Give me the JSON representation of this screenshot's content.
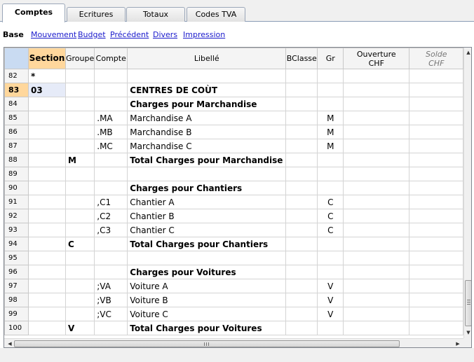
{
  "tabs": [
    {
      "label": "Comptes",
      "active": true
    },
    {
      "label": "Ecritures",
      "active": false
    },
    {
      "label": "Totaux",
      "active": false
    },
    {
      "label": "Codes TVA",
      "active": false
    }
  ],
  "views": {
    "current": "Base",
    "links": [
      "Mouvement",
      "Budget",
      "Précédent",
      "Divers",
      "Impression"
    ]
  },
  "columns": {
    "section": "Section",
    "groupe": "Groupe",
    "compte": "Compte",
    "libelle": "Libellé",
    "bclasse": "BClasse",
    "gr": "Gr",
    "ouverture_line1": "Ouverture",
    "ouverture_line2": "CHF",
    "solde_line1": "Solde",
    "solde_line2": "CHF"
  },
  "current_row": "83",
  "rows": [
    {
      "n": "82",
      "section": "*",
      "groupe": "",
      "compte": "",
      "libelle": "",
      "bclasse": "",
      "gr": "",
      "bold": false
    },
    {
      "n": "83",
      "section": "03",
      "groupe": "",
      "compte": "",
      "libelle": "CENTRES DE COÙT",
      "bclasse": "",
      "gr": "",
      "bold": true
    },
    {
      "n": "84",
      "section": "",
      "groupe": "",
      "compte": "",
      "libelle": "Charges pour Marchandise",
      "bclasse": "",
      "gr": "",
      "bold": true
    },
    {
      "n": "85",
      "section": "",
      "groupe": "",
      "compte": ".MA",
      "libelle": "Marchandise A",
      "bclasse": "",
      "gr": "M",
      "bold": false
    },
    {
      "n": "86",
      "section": "",
      "groupe": "",
      "compte": ".MB",
      "libelle": "Marchandise B",
      "bclasse": "",
      "gr": "M",
      "bold": false
    },
    {
      "n": "87",
      "section": "",
      "groupe": "",
      "compte": ".MC",
      "libelle": "Marchandise C",
      "bclasse": "",
      "gr": "M",
      "bold": false
    },
    {
      "n": "88",
      "section": "",
      "groupe": "M",
      "compte": "",
      "libelle": "Total Charges pour Marchandise",
      "bclasse": "",
      "gr": "",
      "bold": true
    },
    {
      "n": "89",
      "section": "",
      "groupe": "",
      "compte": "",
      "libelle": "",
      "bclasse": "",
      "gr": "",
      "bold": false
    },
    {
      "n": "90",
      "section": "",
      "groupe": "",
      "compte": "",
      "libelle": "Charges pour Chantiers",
      "bclasse": "",
      "gr": "",
      "bold": true
    },
    {
      "n": "91",
      "section": "",
      "groupe": "",
      "compte": ",C1",
      "libelle": "Chantier A",
      "bclasse": "",
      "gr": "C",
      "bold": false
    },
    {
      "n": "92",
      "section": "",
      "groupe": "",
      "compte": ",C2",
      "libelle": "Chantier B",
      "bclasse": "",
      "gr": "C",
      "bold": false
    },
    {
      "n": "93",
      "section": "",
      "groupe": "",
      "compte": ",C3",
      "libelle": "Chantier C",
      "bclasse": "",
      "gr": "C",
      "bold": false
    },
    {
      "n": "94",
      "section": "",
      "groupe": "C",
      "compte": "",
      "libelle": "Total Charges pour Chantiers",
      "bclasse": "",
      "gr": "",
      "bold": true
    },
    {
      "n": "95",
      "section": "",
      "groupe": "",
      "compte": "",
      "libelle": "",
      "bclasse": "",
      "gr": "",
      "bold": false
    },
    {
      "n": "96",
      "section": "",
      "groupe": "",
      "compte": "",
      "libelle": "Charges pour Voitures",
      "bclasse": "",
      "gr": "",
      "bold": true
    },
    {
      "n": "97",
      "section": "",
      "groupe": "",
      "compte": ";VA",
      "libelle": "Voiture A",
      "bclasse": "",
      "gr": "V",
      "bold": false
    },
    {
      "n": "98",
      "section": "",
      "groupe": "",
      "compte": ";VB",
      "libelle": "Voiture B",
      "bclasse": "",
      "gr": "V",
      "bold": false
    },
    {
      "n": "99",
      "section": "",
      "groupe": "",
      "compte": ";VC",
      "libelle": "Voiture C",
      "bclasse": "",
      "gr": "V",
      "bold": false
    },
    {
      "n": "100",
      "section": "",
      "groupe": "V",
      "compte": "",
      "libelle": "Total Charges pour Voitures",
      "bclasse": "",
      "gr": "",
      "bold": true
    }
  ],
  "colors": {
    "selected_header": "#ffd79c",
    "current_row_cell": "#e6ebf8",
    "link": "#1a1acc",
    "corner": "#c9dbf2"
  },
  "icons": {
    "scroll_up": "scroll-up-arrow-icon",
    "scroll_down": "scroll-down-arrow-icon",
    "scroll_left": "scroll-left-arrow-icon",
    "scroll_right": "scroll-right-arrow-icon"
  }
}
